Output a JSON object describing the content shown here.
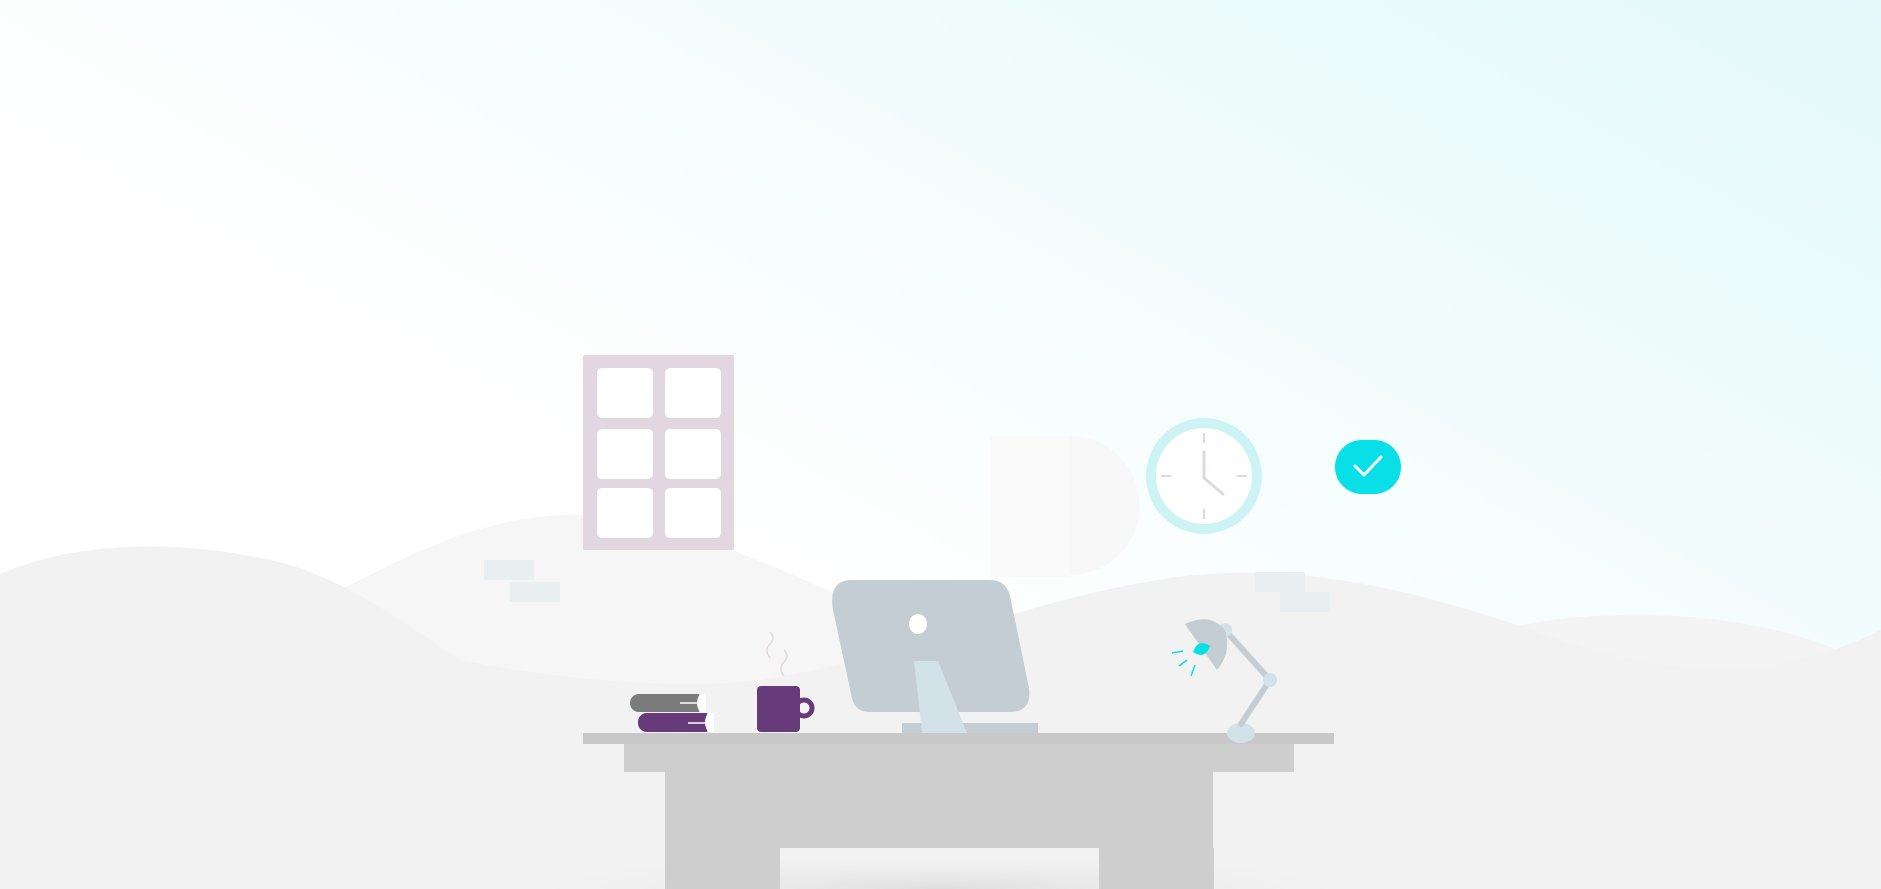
{
  "scene": {
    "description_free": true,
    "colors": {
      "sky_top": "#e8fbfb",
      "sky_bottom": "#ffffff",
      "hill_back": "#f6f6f6",
      "hill_front": "#f2f2f2",
      "desk": "#cecece",
      "desk_top": "#c8c8c8",
      "monitor": "#c3cdd3",
      "monitor_stand": "#d3e2e8",
      "window_frame": "#e2d7e1",
      "clock_ring": "#cdf3f4",
      "accent": "#08dfe7",
      "mug": "#673a7a",
      "book_grey": "#7b7b7b",
      "book_purple": "#673a7a",
      "lamp": "#c3cdd3"
    },
    "icons": {
      "check": "check-icon",
      "clock": "clock-icon",
      "window": "window-icon",
      "monitor": "monitor-icon",
      "lamp": "desk-lamp-icon",
      "mug": "coffee-mug-icon",
      "books": "books-icon"
    }
  }
}
